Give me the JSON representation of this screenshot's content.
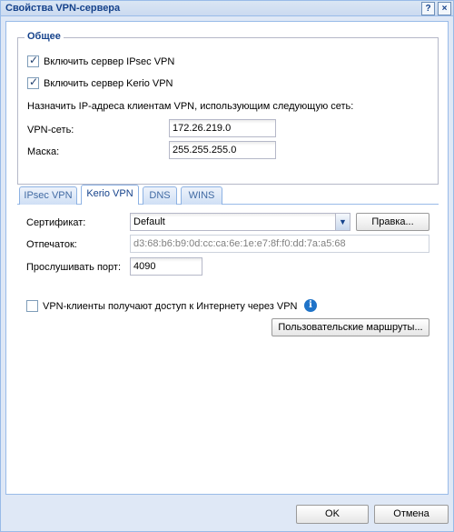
{
  "window": {
    "title": "Свойства VPN-сервера",
    "help_icon": "?",
    "close_icon": "×"
  },
  "general": {
    "legend": "Общее",
    "ipsec_checkbox_label": "Включить сервер IPsec VPN",
    "ipsec_checked": true,
    "kerio_checkbox_label": "Включить сервер Kerio VPN",
    "kerio_checked": true,
    "assign_ip_text": "Назначить IP-адреса клиентам VPN, использующим следующую сеть:",
    "vpn_network_label": "VPN-сеть:",
    "vpn_network_value": "172.26.219.0",
    "mask_label": "Маска:",
    "mask_value": "255.255.255.0"
  },
  "tabs": [
    {
      "label": "IPsec VPN",
      "active": false
    },
    {
      "label": "Kerio VPN",
      "active": true
    },
    {
      "label": "DNS",
      "active": false
    },
    {
      "label": "WINS",
      "active": false
    }
  ],
  "kerio": {
    "certificate_label": "Сертификат:",
    "certificate_value": "Default",
    "edit_button": "Правка...",
    "fingerprint_label": "Отпечаток:",
    "fingerprint_value": "d3:68:b6:b9:0d:cc:ca:6e:1e:e7:8f:f0:dd:7a:a5:68",
    "port_label": "Прослушивать порт:",
    "port_value": "4090",
    "internet_access_label": "VPN-клиенты получают доступ к Интернету через VPN",
    "internet_access_checked": false,
    "info_icon": "i",
    "custom_routes_button": "Пользовательские маршруты..."
  },
  "footer": {
    "ok_button": "OK",
    "cancel_button": "Отмена"
  },
  "colors": {
    "window_bg": "#dfe8f6",
    "border": "#99bbe8",
    "title_text": "#15428b",
    "info_icon_bg": "#1f73c8"
  }
}
